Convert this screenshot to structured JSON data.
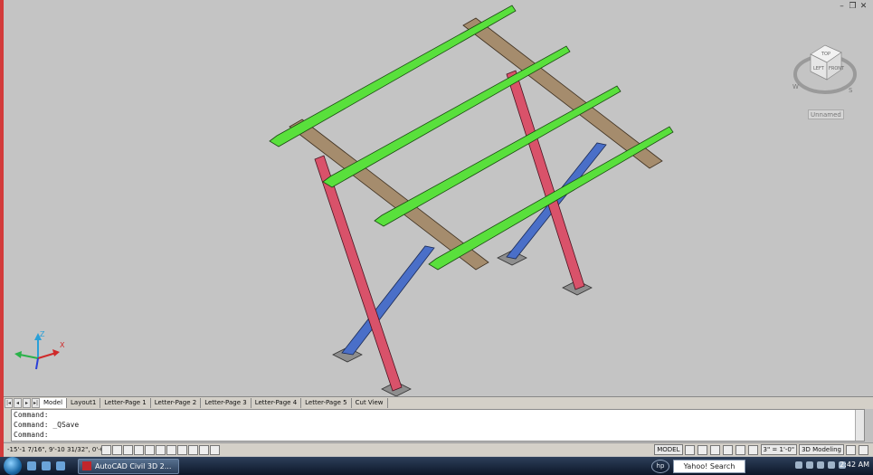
{
  "window_controls": {
    "minimize": "–",
    "restore": "❐",
    "close": "✕"
  },
  "viewcube": {
    "top_label": "TOP",
    "left_label": "LEFT",
    "front_label": "FRONT",
    "compass_w": "W",
    "compass_s": "S"
  },
  "view_dropdown": "Unnamed",
  "ucs": {
    "z": "Z",
    "x": "X"
  },
  "layout_tabs": [
    "Model",
    "Layout1",
    "Letter-Page 1",
    "Letter-Page 2",
    "Letter-Page 3",
    "Letter-Page 4",
    "Letter-Page 5",
    "Cut View"
  ],
  "command_lines": [
    "Command:",
    "Command: _QSave",
    "Command:"
  ],
  "status_bar": {
    "coordinates": "-15'-1 7/16\", 9'-10 31/32\", 0'-0\"",
    "model_label": "MODEL",
    "annotation_scale": "3\" = 1'-0\"",
    "workspace": "3D Modeling"
  },
  "taskbar": {
    "active_window": "AutoCAD Civil 3D 2...",
    "search_placeholder": "Yahoo! Search",
    "clock": "2:42 AM",
    "hp_logo": "hp"
  },
  "colors": {
    "viewport_bg": "#c4c4c4",
    "green_rafter": "#59e03c",
    "tan_beam": "#a58c6d",
    "red_leg": "#d9526a",
    "blue_brace": "#4a6fc8",
    "left_border": "#d33b3b"
  }
}
